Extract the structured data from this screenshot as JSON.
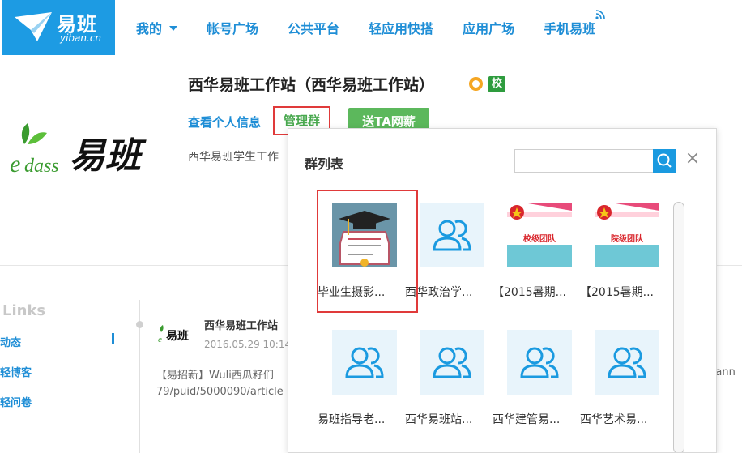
{
  "logo": {
    "cn": "易班",
    "en": "yiban.cn"
  },
  "nav": [
    {
      "label": "我的"
    },
    {
      "label": "帐号广场"
    },
    {
      "label": "公共平台"
    },
    {
      "label": "轻应用快搭"
    },
    {
      "label": "应用广场"
    },
    {
      "label": "手机易班"
    }
  ],
  "profile": {
    "title": "西华易班工作站（西华易班工作站）",
    "badge_xiao": "校",
    "link_info": "查看个人信息",
    "link_manage": "管理群",
    "btn_gift": "送TA网薪",
    "desc": "西华易班学生工作",
    "logo_text": "易班"
  },
  "sidebar": {
    "title": "Links",
    "items": [
      {
        "label": "动态"
      },
      {
        "label": "轻博客"
      },
      {
        "label": "轻问卷"
      }
    ]
  },
  "post": {
    "author": "西华易班工作站",
    "date": "2016.05.29 10:14",
    "text1": "【易招新】Wuli西瓜籽们",
    "text2": "79/puid/5000090/article",
    "text_right": "chann"
  },
  "popup": {
    "title": "群列表",
    "close": "×",
    "groups": [
      {
        "name": "毕业生摄影...",
        "thumb": "diploma"
      },
      {
        "name": "西华政治学...",
        "thumb": "users-icon"
      },
      {
        "name": "【2015暑期...",
        "thumb": "league-banner",
        "banner": "校级团队"
      },
      {
        "name": "【2015暑期...",
        "thumb": "league-banner",
        "banner": "院级团队"
      },
      {
        "name": "易班指导老...",
        "thumb": "users-icon"
      },
      {
        "name": "西华易班站...",
        "thumb": "users-icon"
      },
      {
        "name": "西华建管易...",
        "thumb": "users-icon"
      },
      {
        "name": "西华艺术易...",
        "thumb": "users-icon"
      }
    ]
  },
  "colors": {
    "brand": "#1d9be3",
    "link": "#1f8ed6",
    "green": "#5cb85c",
    "highlight": "#e03a3a"
  }
}
